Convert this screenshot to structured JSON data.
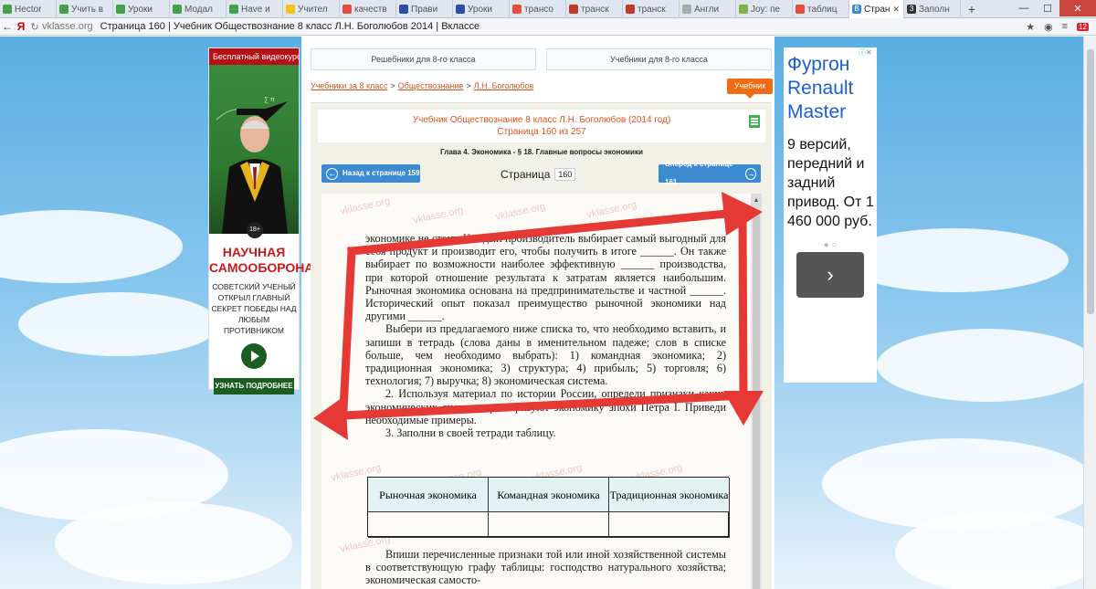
{
  "browser": {
    "tabs": [
      {
        "label": "Hector",
        "color": "#46a24a"
      },
      {
        "label": "Учить в",
        "color": "#46a24a"
      },
      {
        "label": "Уроки",
        "color": "#46a24a"
      },
      {
        "label": "Модал",
        "color": "#46a24a"
      },
      {
        "label": "Have и",
        "color": "#46a24a"
      },
      {
        "label": "Учител",
        "color": "#f1c40f"
      },
      {
        "label": "качеств",
        "color": "#e74c3c"
      },
      {
        "label": "Прави",
        "color": "#2c4fa3"
      },
      {
        "label": "Уроки",
        "color": "#2c4fa3"
      },
      {
        "label": "трансо",
        "color": "#e74c3c"
      },
      {
        "label": "транск",
        "color": "#c0392b"
      },
      {
        "label": "транск",
        "color": "#c0392b"
      },
      {
        "label": "Англи",
        "color": "#aaaaaa"
      },
      {
        "label": "Joy: пе",
        "color": "#7cb342"
      },
      {
        "label": "таблиц",
        "color": "#e74c3c"
      }
    ],
    "active_tab": {
      "label": "Стран",
      "icon_letter": "В",
      "color": "#3c8bd0"
    },
    "extra_tab": {
      "label": "Заполн",
      "icon_letter": "З"
    },
    "new_tab_symbol": "+",
    "domain": "vklasse.org",
    "page_title": "Страница 160 | Учебник Обществознание 8 класс Л.Н. Боголюбов 2014 | Вклассе",
    "badge": "12"
  },
  "site": {
    "btn_reshebniki": "Решебники для 8-го класса",
    "btn_uchebniki": "Учебники для 8-го класса",
    "breadcrumb": [
      "Учебники за 8 класс",
      "Обществознание",
      "Л.Н. Боголюбов"
    ],
    "breadcrumb_sep": ">",
    "tag": "Учебник",
    "book_title": "Учебник Обществознание 8 класс Л.Н. Боголюбов (2014 год)",
    "page_of": "Страница 160 из 257",
    "chapter": "Глава 4. Экономика - § 18. Главные вопросы экономики",
    "prev_label": "Назад к странице 159",
    "next_label": "Вперед к странице 161",
    "page_label": "Страница",
    "page_number": "160",
    "watermark": "vklasse.org"
  },
  "ad_left": {
    "title": "Бесплатный видеокурс",
    "age": "18+",
    "headline": "НАУЧНАЯ САМООБОРОНА",
    "text": "СОВЕТСКИЙ УЧЕНЫЙ ОТКРЫЛ ГЛАВНЫЙ СЕКРЕТ ПОБЕДЫ НАД ЛЮБЫМ ПРОТИВНИКОМ",
    "cta": "УЗНАТЬ ПОДРОБНЕЕ"
  },
  "ad_right": {
    "headline": "Фургон Renault Master",
    "text": "9 версий, передний и задний привод. От 1 460 000 руб.",
    "dots": "● ○",
    "go_symbol": "›"
  },
  "book_text": {
    "para1": "экономике не стоит. Каждый производитель выбирает самый выгодный для себя продукт и производит его, чтобы получить в итоге ______. Он также выбирает по возможности наиболее эффективную ______ производства, при которой отношение результата к затратам является наибольшим. Рыночная экономика основана на предпринимательстве и частной ______. Исторический опыт показал преимущество рыночной экономики над другими ______.",
    "para2": "Выбери из предлагаемого ниже списка то, что необходимо вставить, и запиши в тетрадь (слова даны в именительном падеже; слов в списке больше, чем необходимо выбрать): 1) командная экономика; 2) традиционная экономика; 3) структура; 4) прибыль; 5) торговля; 6) технология; 7) выручка; 8) экономическая система.",
    "para3": "2. Используя материал по истории России, определи признаки каких экономических систем характеризуют экономику эпохи Петра I. Приведи необходимые примеры.",
    "para4": "3. Заполни в своей тетради таблицу.",
    "table_headers": [
      "Рыночная экономика",
      "Командная экономика",
      "Традиционная экономика"
    ],
    "para5": "Впиши перечисленные признаки той или иной хозяйственной системы в соответствующую графу таблицы: господство натурального хозяйства; экономическая самосто-"
  }
}
